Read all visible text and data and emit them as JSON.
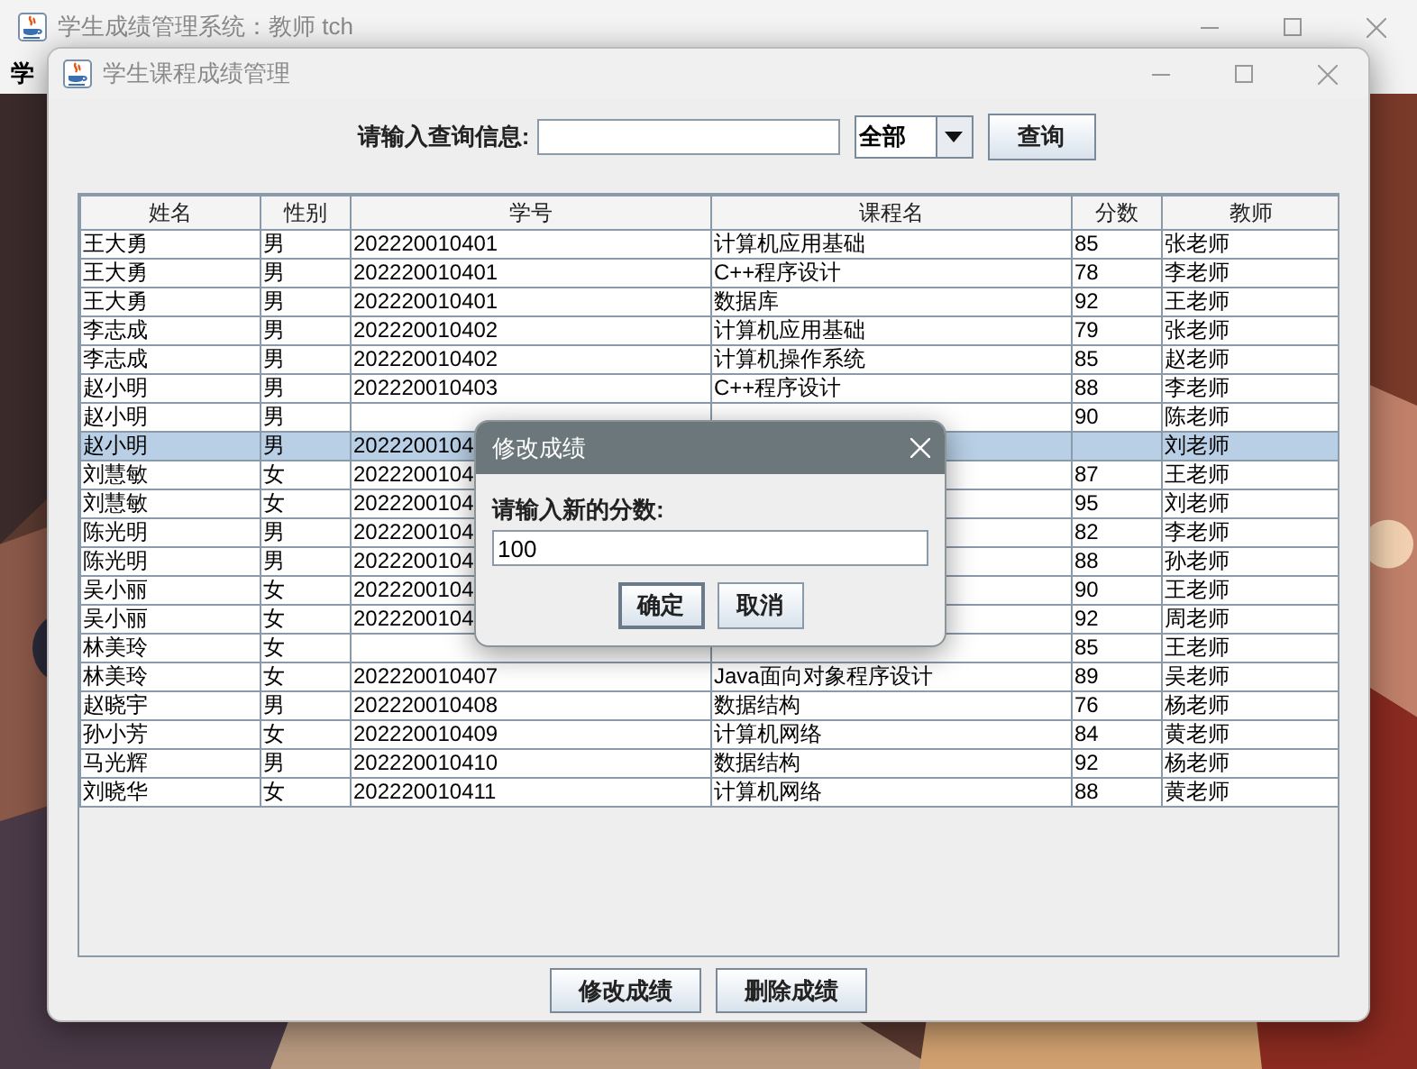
{
  "back_window": {
    "title": "学生成绩管理系统：教师 tch",
    "menu": [
      "学"
    ]
  },
  "window": {
    "title": "学生课程成绩管理"
  },
  "query": {
    "label": "请输入查询信息:",
    "filter": "全部",
    "button": "查询"
  },
  "table": {
    "columns": [
      "姓名",
      "性别",
      "学号",
      "课程名",
      "分数",
      "教师"
    ],
    "rows": [
      {
        "name": "王大勇",
        "gender": "男",
        "id": "202220010401",
        "course": "计算机应用基础",
        "score": "85",
        "teacher": "张老师",
        "selected": false
      },
      {
        "name": "王大勇",
        "gender": "男",
        "id": "202220010401",
        "course": "C++程序设计",
        "score": "78",
        "teacher": "李老师",
        "selected": false
      },
      {
        "name": "王大勇",
        "gender": "男",
        "id": "202220010401",
        "course": "数据库",
        "score": "92",
        "teacher": "王老师",
        "selected": false
      },
      {
        "name": "李志成",
        "gender": "男",
        "id": "202220010402",
        "course": "计算机应用基础",
        "score": "79",
        "teacher": "张老师",
        "selected": false
      },
      {
        "name": "李志成",
        "gender": "男",
        "id": "202220010402",
        "course": "计算机操作系统",
        "score": "85",
        "teacher": "赵老师",
        "selected": false
      },
      {
        "name": "赵小明",
        "gender": "男",
        "id": "202220010403",
        "course": "C++程序设计",
        "score": "88",
        "teacher": "李老师",
        "selected": false
      },
      {
        "name": "赵小明",
        "gender": "男",
        "score": "90",
        "teacher": "陈老师",
        "selected": false
      },
      {
        "name": "赵小明",
        "gender": "男",
        "id": "2022200104",
        "teacher": "刘老师",
        "selected": true
      },
      {
        "name": "刘慧敏",
        "gender": "女",
        "id": "2022200104",
        "score": "87",
        "teacher": "王老师",
        "selected": false
      },
      {
        "name": "刘慧敏",
        "gender": "女",
        "id": "2022200104",
        "score": "95",
        "teacher": "刘老师",
        "selected": false
      },
      {
        "name": "陈光明",
        "gender": "男",
        "id": "2022200104",
        "score": "82",
        "teacher": "李老师",
        "selected": false
      },
      {
        "name": "陈光明",
        "gender": "男",
        "id": "2022200104",
        "score": "88",
        "teacher": "孙老师",
        "selected": false
      },
      {
        "name": "吴小丽",
        "gender": "女",
        "id": "2022200104",
        "score": "90",
        "teacher": "王老师",
        "selected": false
      },
      {
        "name": "吴小丽",
        "gender": "女",
        "id": "2022200104",
        "score": "92",
        "teacher": "周老师",
        "selected": false
      },
      {
        "name": "林美玲",
        "gender": "女",
        "score": "85",
        "teacher": "王老师",
        "selected": false
      },
      {
        "name": "林美玲",
        "gender": "女",
        "id": "202220010407",
        "course": "Java面向对象程序设计",
        "score": "89",
        "teacher": "吴老师",
        "selected": false
      },
      {
        "name": "赵晓宇",
        "gender": "男",
        "id": "202220010408",
        "course": "数据结构",
        "score": "76",
        "teacher": "杨老师",
        "selected": false
      },
      {
        "name": "孙小芳",
        "gender": "女",
        "id": "202220010409",
        "course": "计算机网络",
        "score": "84",
        "teacher": "黄老师",
        "selected": false
      },
      {
        "name": "马光辉",
        "gender": "男",
        "id": "202220010410",
        "course": "数据结构",
        "score": "92",
        "teacher": "杨老师",
        "selected": false
      },
      {
        "name": "刘晓华",
        "gender": "女",
        "id": "202220010411",
        "course": "计算机网络",
        "score": "88",
        "teacher": "黄老师",
        "selected": false
      }
    ]
  },
  "buttons": [
    "修改成绩",
    "删除成绩"
  ],
  "dialog": {
    "title": "修改成绩",
    "label": "请输入新的分数:",
    "value": "100",
    "buttons": [
      {
        "label": "确定",
        "focused": true
      },
      {
        "label": "取消",
        "focused": false
      }
    ]
  }
}
